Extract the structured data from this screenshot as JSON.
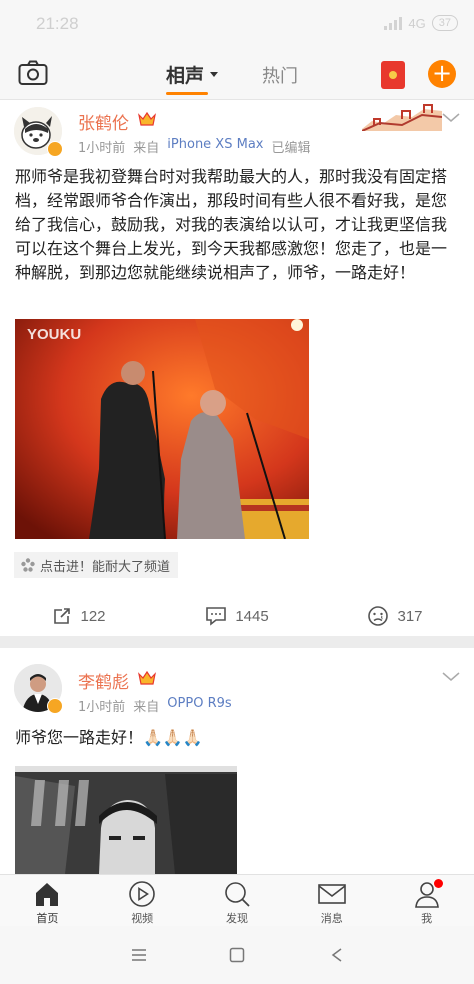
{
  "status": {
    "time": "21:28",
    "network": "4G",
    "battery": "37"
  },
  "header": {
    "active_tab": "相声",
    "other_tab": "热门"
  },
  "posts": [
    {
      "author": "张鹤伦",
      "time": "1小时前",
      "source_prefix": "来自",
      "source": "iPhone XS Max",
      "edited": "已编辑",
      "text": "邢师爷是我初登舞台时对我帮助最大的人，那时我没有固定搭档，经常跟师爷合作演出，那段时间有些人很不看好我，是您给了我信心，鼓励我，对我的表演给以认可，才让我更坚信我可以在这个舞台上发光，到今天我都感激您！您走了，也是一种解脱，到那边您就能继续说相声了，师爷，一路走好！",
      "video_watermark": "YOUKU",
      "topic": "点击进！能耐大了频道",
      "reposts": "122",
      "comments": "1445",
      "likes": "317"
    },
    {
      "author": "李鹤彪",
      "time": "1小时前",
      "source_prefix": "来自",
      "source": "OPPO R9s",
      "text": "师爷您一路走好！🙏🏻🙏🏻🙏🏻"
    }
  ],
  "tabbar": {
    "items": [
      {
        "label": "首页",
        "icon": "home-icon"
      },
      {
        "label": "视频",
        "icon": "video-icon"
      },
      {
        "label": "发现",
        "icon": "discover-icon"
      },
      {
        "label": "消息",
        "icon": "message-icon"
      },
      {
        "label": "我",
        "icon": "profile-icon"
      }
    ]
  },
  "colors": {
    "accent": "#ff8200",
    "author": "#eb7350",
    "link": "#5d7ec2"
  }
}
